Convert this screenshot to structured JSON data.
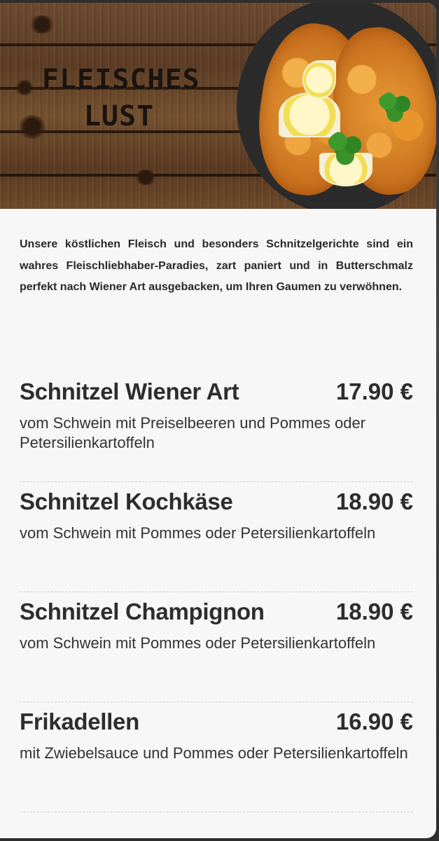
{
  "hero": {
    "title_line1": "FLEISCHES",
    "title_line2": "LUST"
  },
  "intro": "Unsere köstlichen Fleisch und besonders Schnitzelgerichte sind ein wahres Fleischliebhaber-Paradies, zart paniert und in Butterschmalz perfekt nach Wiener Art ausgebacken, um Ihren Gaumen zu verwöhnen.",
  "menu": {
    "items": [
      {
        "name": "Schnitzel Wiener Art",
        "price": "17.90 €",
        "description": "vom Schwein mit Preiselbeeren und Pommes oder Petersilienkartoffeln"
      },
      {
        "name": "Schnitzel Kochkäse",
        "price": "18.90 €",
        "description": "vom Schwein mit Pommes oder Petersilienkartoffeln"
      },
      {
        "name": "Schnitzel Champignon",
        "price": "18.90 €",
        "description": "vom Schwein mit Pommes oder Petersilienkartoffeln"
      },
      {
        "name": "Frikadellen",
        "price": "16.90 €",
        "description": "mit Zwiebelsauce und Pommes oder Petersilienkartoffeln"
      }
    ]
  },
  "colors": {
    "card_background": "#f7f7f7",
    "text": "#2d2d2d",
    "divider": "#cfcfcf"
  }
}
